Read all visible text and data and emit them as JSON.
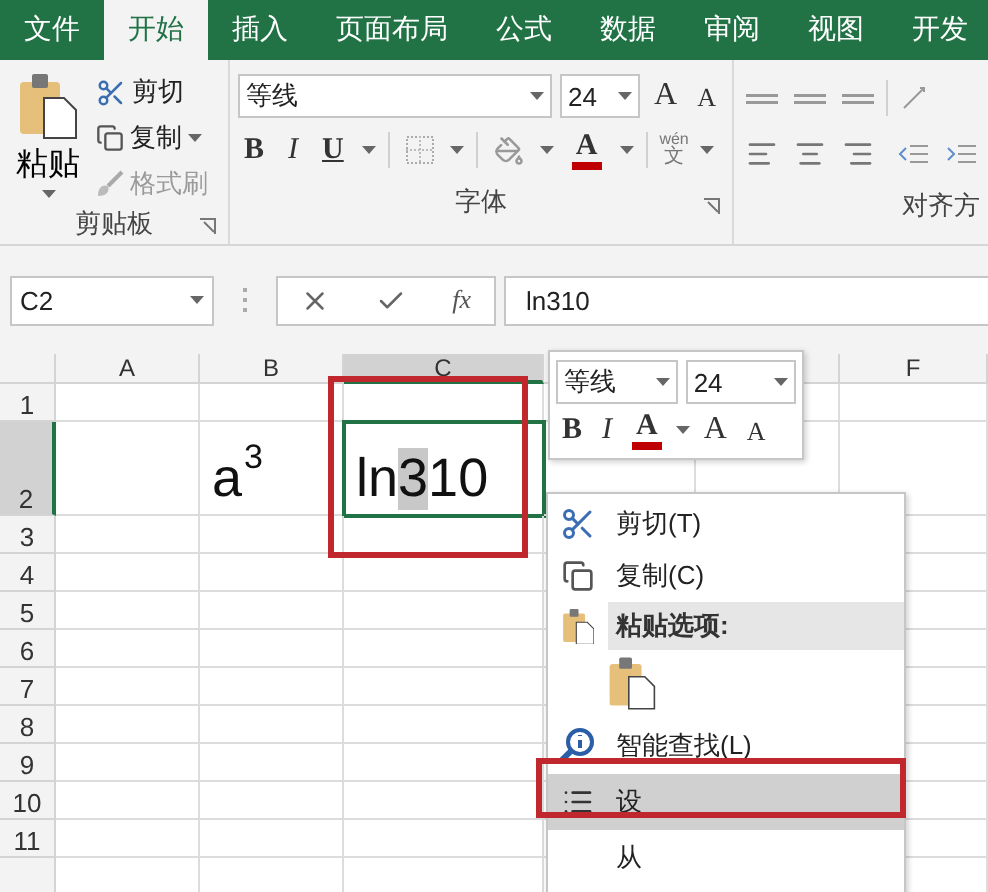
{
  "tabs": [
    {
      "label": "文件",
      "selected": false
    },
    {
      "label": "开始",
      "selected": true
    },
    {
      "label": "插入",
      "selected": false
    },
    {
      "label": "页面布局",
      "selected": false
    },
    {
      "label": "公式",
      "selected": false
    },
    {
      "label": "数据",
      "selected": false
    },
    {
      "label": "审阅",
      "selected": false
    },
    {
      "label": "视图",
      "selected": false
    },
    {
      "label": "开发",
      "selected": false
    }
  ],
  "ribbon": {
    "clipboard": {
      "paste": "粘贴",
      "cut": "剪切",
      "copy": "复制",
      "format_painter": {
        "label": "格式刷",
        "disabled": true
      },
      "group_label": "剪贴板"
    },
    "font": {
      "font_name": "等线",
      "font_size": "24",
      "grow": "A",
      "shrink": "A",
      "bold": "B",
      "italic": "I",
      "underline": "U",
      "font_color": "A",
      "phonetic": {
        "top": "wén",
        "bottom": "文"
      },
      "group_label": "字体"
    },
    "alignment": {
      "group_label": "对齐方"
    }
  },
  "formula_bar": {
    "name_box": "C2",
    "function": "fx",
    "value": "ln310"
  },
  "sheet": {
    "columns": [
      {
        "label": "A",
        "selected": false
      },
      {
        "label": "B",
        "selected": false
      },
      {
        "label": "C",
        "selected": true
      },
      {
        "label": "F",
        "selected": false
      }
    ],
    "rows": [
      {
        "label": "1",
        "selected": false,
        "cells": []
      },
      {
        "label": "2",
        "selected": true,
        "cells": [
          null,
          {
            "text": "a$^{3}$"
          },
          {
            "active": true,
            "parts": [
              {
                "text": "ln",
                "selected": false
              },
              {
                "text": "3",
                "selected": true
              },
              {
                "text": "10",
                "selected": false
              }
            ]
          }
        ]
      },
      {
        "label": "3",
        "selected": false,
        "cells": []
      },
      {
        "label": "4",
        "selected": false,
        "cells": []
      },
      {
        "label": "5",
        "selected": false,
        "cells": []
      },
      {
        "label": "6",
        "selected": false,
        "cells": []
      },
      {
        "label": "7",
        "selected": false,
        "cells": []
      },
      {
        "label": "8",
        "selected": false,
        "cells": []
      },
      {
        "label": "9",
        "selected": false,
        "cells": []
      },
      {
        "label": "10",
        "selected": false,
        "cells": []
      },
      {
        "label": "11",
        "selected": false,
        "cells": []
      }
    ]
  },
  "mini_toolbar": {
    "font_name": "等线",
    "font_size": "24",
    "bold": "B",
    "italic": "I",
    "font_color": "A",
    "grow": "A",
    "shrink": "A"
  },
  "context_menu": {
    "items": [
      {
        "kind": "cut",
        "label": "剪切(T)",
        "selected": false
      },
      {
        "kind": "copy",
        "label": "复制(C)",
        "selected": false
      },
      {
        "kind": "pasteheader",
        "label": "粘贴选项:"
      },
      {
        "kind": "pasteoption",
        "selected": false
      },
      {
        "kind": "lookup",
        "label": "智能查找(L)",
        "selected": false
      },
      {
        "kind": "format",
        "label": "设",
        "selected": true
      },
      {
        "kind": "plain",
        "label": "从",
        "selected": false
      }
    ]
  }
}
